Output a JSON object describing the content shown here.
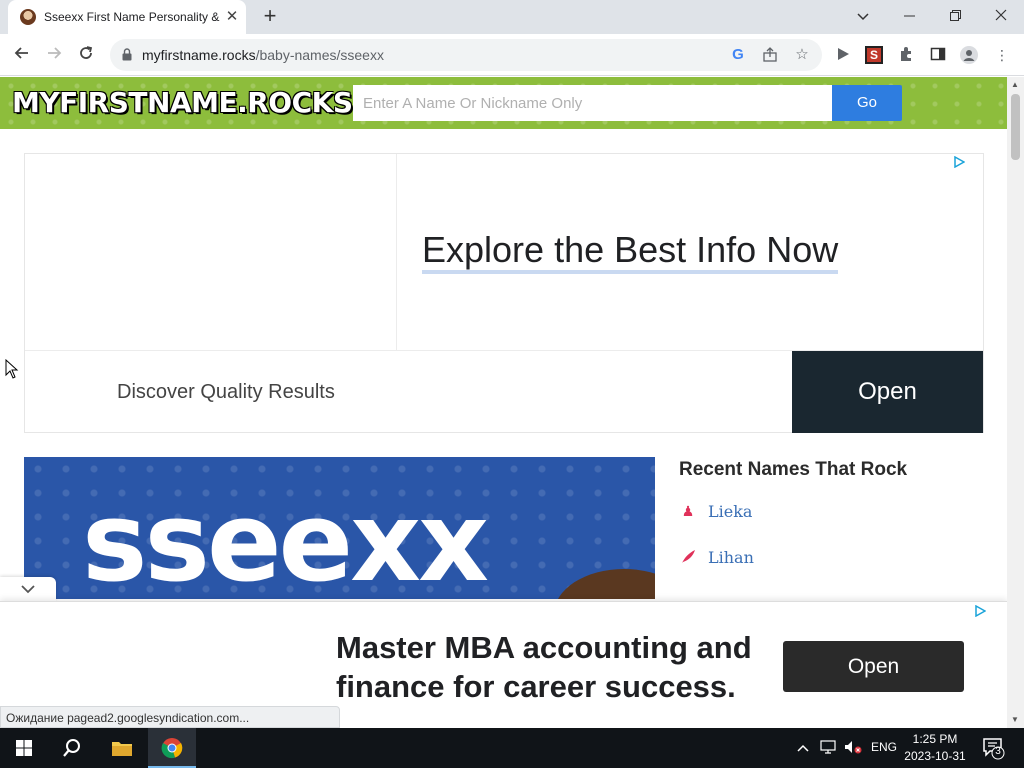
{
  "browser": {
    "tab_title": "Sseexx First Name Personality &",
    "tab_close": "✕",
    "new_tab": "+",
    "url_host": "myfirstname.rocks",
    "url_path": "/baby-names/sseexx",
    "status_text": "Ожидание pagead2.googlesyndication.com..."
  },
  "site": {
    "logo": "MYFIRSTNAME.ROCKS",
    "search_placeholder": "Enter A Name Or Nickname Only",
    "go_label": "Go"
  },
  "ad_top": {
    "headline": "Explore the Best Info Now",
    "subtext": "Discover Quality Results",
    "cta": "Open"
  },
  "hero": {
    "name": "sseexx"
  },
  "sidebar": {
    "title": "Recent Names That Rock",
    "items": [
      {
        "label": "Lieka",
        "icon": "chess-pawn-icon"
      },
      {
        "label": "Lihan",
        "icon": "feather-icon"
      }
    ]
  },
  "ad_bottom": {
    "headline": "Master MBA accounting and finance for career success.",
    "cta": "Open"
  },
  "taskbar": {
    "language": "ENG",
    "time": "1:25 PM",
    "date": "2023-10-31",
    "notification_count": "3"
  },
  "colors": {
    "header_green": "#8dbd3c",
    "go_blue": "#2e7de0",
    "hero_blue": "#2a56a8",
    "link_blue": "#3a6fb5",
    "accent_red": "#e0315a"
  }
}
